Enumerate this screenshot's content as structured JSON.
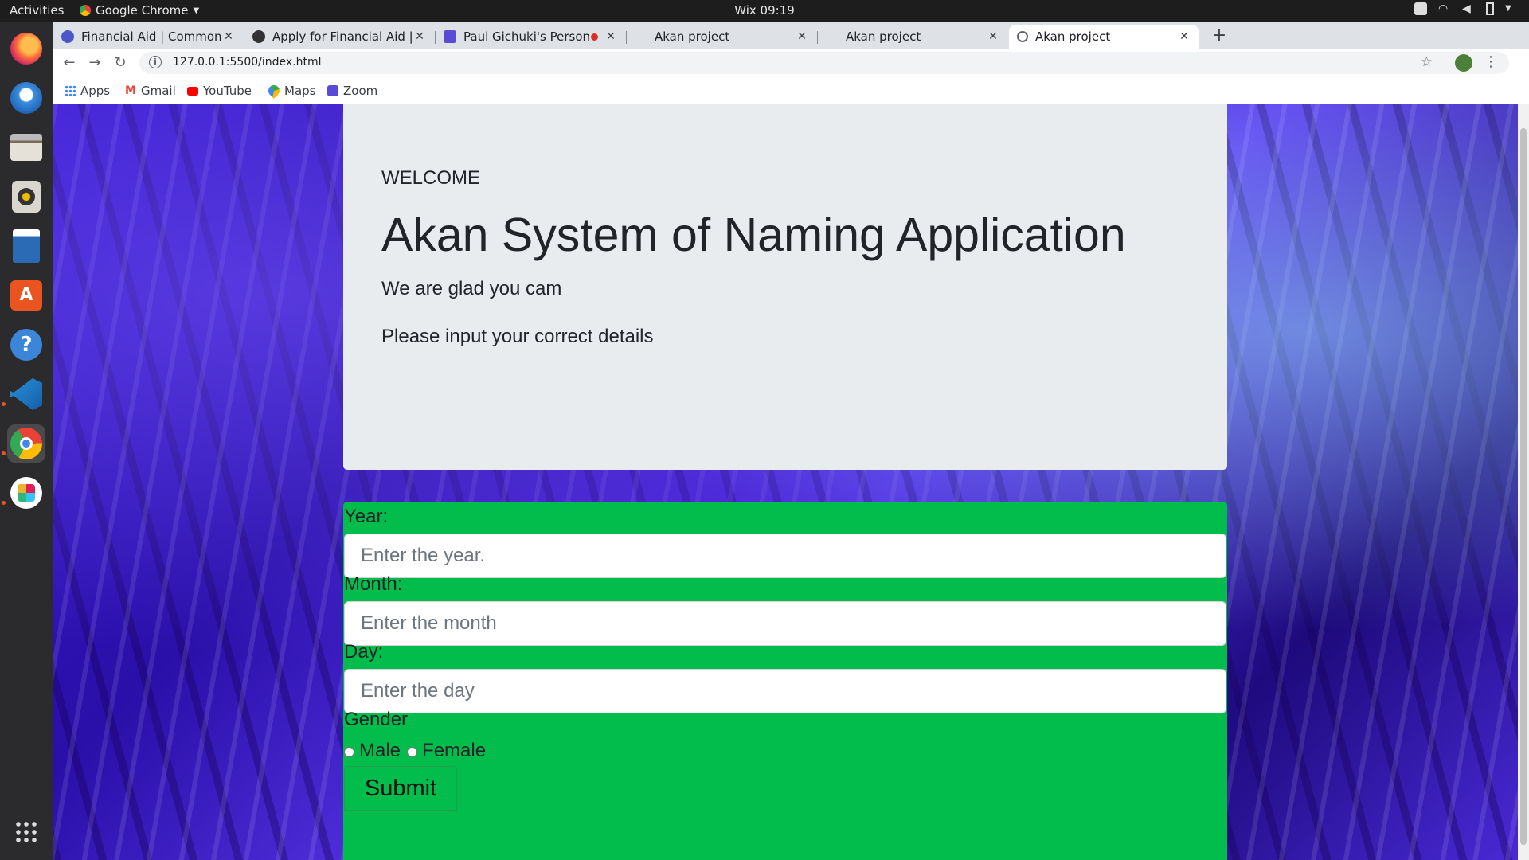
{
  "topbar": {
    "activities": "Activities",
    "app_name": "Google Chrome",
    "clock": "Wix 09:19"
  },
  "dock": {
    "items": [
      "firefox-icon",
      "thunderbird-icon",
      "files-icon",
      "rhythmbox-icon",
      "writer-icon",
      "software-center-icon",
      "help-icon",
      "vscode-icon",
      "chrome-icon",
      "slack-icon",
      "show-apps-icon"
    ]
  },
  "tabs": [
    {
      "title": "Financial Aid | Common A",
      "favicon_color": "#4a56c9"
    },
    {
      "title": "Apply for Financial Aid | Fi",
      "favicon_color": "#333333"
    },
    {
      "title": "Paul Gichuki's Persona",
      "favicon_color": "#5b4ad6"
    },
    {
      "title": "Akan project",
      "favicon_color": "#dee1e6"
    },
    {
      "title": "Akan project",
      "favicon_color": "#dee1e6"
    },
    {
      "title": "Akan project",
      "favicon_color": "#5f6368"
    }
  ],
  "address_bar": {
    "url": "127.0.0.1:5500/index.html"
  },
  "bookmarks": [
    {
      "label": "Apps",
      "color": "#4285f4"
    },
    {
      "label": "Gmail",
      "color": "#ea4335"
    },
    {
      "label": "YouTube",
      "color": "#ff0000"
    },
    {
      "label": "Maps",
      "color": "#34a853"
    },
    {
      "label": "Zoom",
      "color": "#5b4ad6"
    }
  ],
  "page": {
    "welcome": "WELCOME",
    "title": "Akan System of Naming Application",
    "subtitle": "We are glad you cam",
    "instruction": "Please input your correct details"
  },
  "form": {
    "year_label": "Year:",
    "year_placeholder": "Enter the year.",
    "month_label": "Month:",
    "month_placeholder": "Enter the month",
    "day_label": "Day:",
    "day_placeholder": "Enter the day",
    "gender_label": "Gender",
    "male_label": "Male",
    "female_label": "Female",
    "submit_label": "Submit"
  },
  "colors": {
    "form_bg": "#02bd4c",
    "jumbotron_bg": "#e9ecef",
    "accent": "#e95420"
  }
}
